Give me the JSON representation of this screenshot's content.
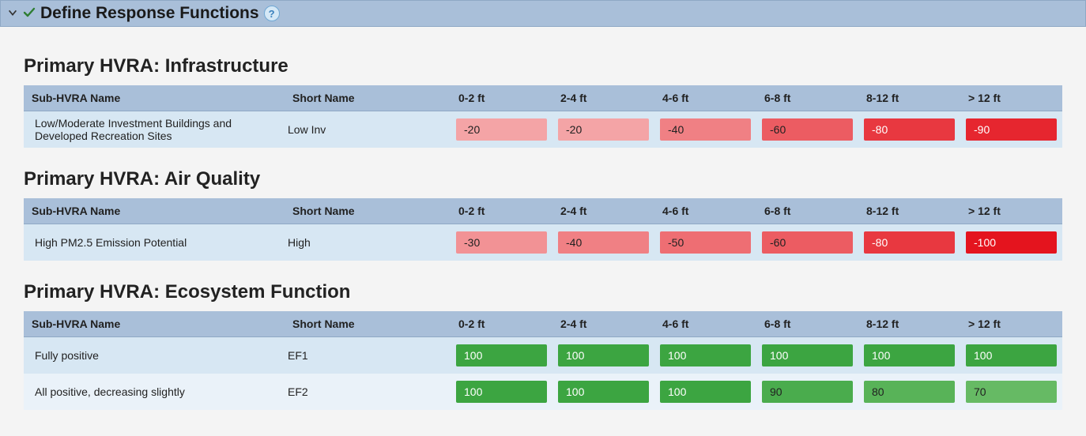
{
  "panel": {
    "title": "Define Response Functions",
    "help_tooltip": "?"
  },
  "columns": {
    "name": "Sub-HVRA Name",
    "short": "Short Name",
    "ranges": [
      "0-2 ft",
      "2-4 ft",
      "4-6 ft",
      "6-8 ft",
      "8-12 ft",
      "> 12 ft"
    ]
  },
  "sections": [
    {
      "heading": "Primary HVRA: Infrastructure",
      "rows": [
        {
          "name": "Low/Moderate Investment Buildings and Developed Recreation Sites",
          "short": "Low Inv",
          "values": [
            -20,
            -20,
            -40,
            -60,
            -80,
            -90
          ]
        }
      ]
    },
    {
      "heading": "Primary HVRA: Air Quality",
      "rows": [
        {
          "name": "High PM2.5 Emission Potential",
          "short": "High",
          "values": [
            -30,
            -40,
            -50,
            -60,
            -80,
            -100
          ]
        }
      ]
    },
    {
      "heading": "Primary HVRA: Ecosystem Function",
      "rows": [
        {
          "name": "Fully positive",
          "short": "EF1",
          "values": [
            100,
            100,
            100,
            100,
            100,
            100
          ]
        },
        {
          "name": "All positive, decreasing slightly",
          "short": "EF2",
          "values": [
            100,
            100,
            100,
            90,
            80,
            70
          ]
        }
      ]
    }
  ],
  "chart_data": {
    "type": "table",
    "title": "Define Response Functions",
    "columns": [
      "Sub-HVRA Name",
      "Short Name",
      "0-2 ft",
      "2-4 ft",
      "4-6 ft",
      "6-8 ft",
      "8-12 ft",
      "> 12 ft"
    ],
    "groups": [
      {
        "group": "Primary HVRA: Infrastructure",
        "rows": [
          [
            "Low/Moderate Investment Buildings and Developed Recreation Sites",
            "Low Inv",
            -20,
            -20,
            -40,
            -60,
            -80,
            -90
          ]
        ]
      },
      {
        "group": "Primary HVRA: Air Quality",
        "rows": [
          [
            "High PM2.5 Emission Potential",
            "High",
            -30,
            -40,
            -50,
            -60,
            -80,
            -100
          ]
        ]
      },
      {
        "group": "Primary HVRA: Ecosystem Function",
        "rows": [
          [
            "Fully positive",
            "EF1",
            100,
            100,
            100,
            100,
            100,
            100
          ],
          [
            "All positive, decreasing slightly",
            "EF2",
            100,
            100,
            100,
            90,
            80,
            70
          ]
        ]
      }
    ]
  }
}
